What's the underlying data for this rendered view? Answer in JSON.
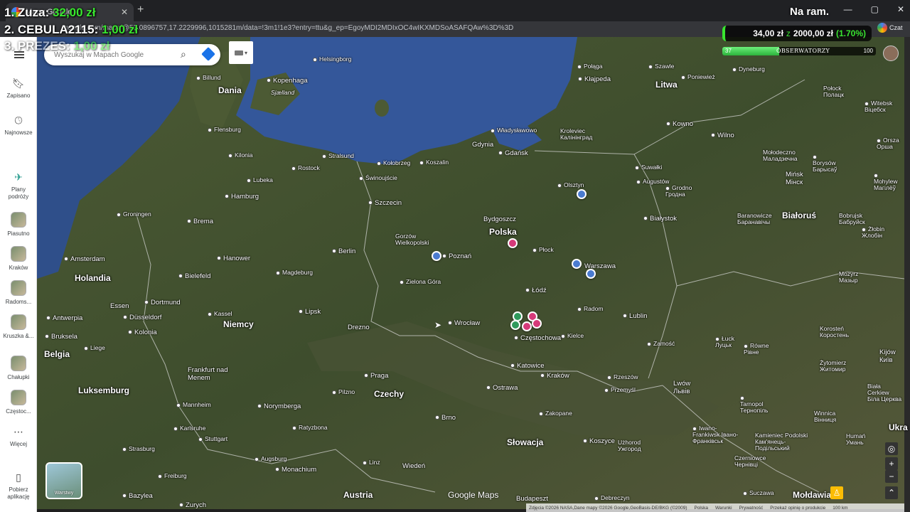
{
  "browser": {
    "tab_title": "Mapy Google",
    "url": "google.com/maps/@52.0896757,17.2229996,1015281m/data=!3m1!1e3?entry=ttu&g_ep=EgoyMDI2MDIxOC4wIKXMDSoASAFQAw%3D%3D",
    "win_min": "—",
    "win_max": "▢",
    "win_close": "✕"
  },
  "stream": {
    "leaders": [
      {
        "name": "1. Zuza:",
        "amount": "32,00 zł"
      },
      {
        "name": "2. CEBULA2115:",
        "amount": "1,00 zł"
      },
      {
        "name": "3. PREZES:",
        "amount": "1,00 zł"
      }
    ],
    "status": "Na ram.",
    "goal": {
      "current": "34,00 zł",
      "of": "z",
      "target": "2000,00 zł",
      "percent": "(1.70%)",
      "fraction": 0.017
    },
    "observers": {
      "count": "37",
      "label": "OBSERWATORZY",
      "max": "100",
      "fraction": 0.37
    },
    "chat_label": "Czat"
  },
  "maps": {
    "search_placeholder": "Wyszukaj w Mapach Google",
    "rail": [
      {
        "label": "Zapisano",
        "icon": "bookmark-icon"
      },
      {
        "label": "Najnowsze",
        "icon": "history-icon"
      },
      {
        "label": "Plany podróży",
        "icon": "trip-icon"
      },
      {
        "label": "Piasutno",
        "icon": "place-thumb"
      },
      {
        "label": "Kraków",
        "icon": "place-thumb"
      },
      {
        "label": "Radoms...",
        "icon": "place-thumb"
      },
      {
        "label": "Kruszka &...",
        "icon": "place-thumb"
      },
      {
        "label": "Chałupki",
        "icon": "place-thumb"
      },
      {
        "label": "Częstoc...",
        "icon": "place-thumb"
      },
      {
        "label": "Więcej",
        "icon": "more-icon"
      },
      {
        "label": "Pobierz aplikację",
        "icon": "phone-icon"
      }
    ],
    "layers_label": "Warstwy",
    "brand": "Google Maps",
    "footer": {
      "credits": "Zdjęcia ©2026 NASA,Dane mapy ©2026 Google,GeoBasis-DE/BKG (©2009)",
      "links": [
        "Polska",
        "Warunki",
        "Prywatność",
        "Przekaż opinię o produkcie"
      ],
      "scale": "100 km"
    },
    "countries": [
      {
        "name": "Dania"
      },
      {
        "name": "Litwa"
      },
      {
        "name": "Polska"
      },
      {
        "name": "Holandia"
      },
      {
        "name": "Niemcy"
      },
      {
        "name": "Belgia"
      },
      {
        "name": "Luksemburg"
      },
      {
        "name": "Czechy"
      },
      {
        "name": "Słowacja"
      },
      {
        "name": "Austria"
      },
      {
        "name": "Białoruś"
      },
      {
        "name": "Mołdawia"
      },
      {
        "name": "Ukra"
      }
    ],
    "cities": [
      {
        "name": "Helsingborg"
      },
      {
        "name": "Kopenhaga"
      },
      {
        "name": "Sjælland"
      },
      {
        "name": "Billund"
      },
      {
        "name": "Flensburg"
      },
      {
        "name": "Kilonia"
      },
      {
        "name": "Lubeka"
      },
      {
        "name": "Rostock"
      },
      {
        "name": "Stralsund"
      },
      {
        "name": "Hamburg"
      },
      {
        "name": "Groningen"
      },
      {
        "name": "Brema"
      },
      {
        "name": "Amsterdam"
      },
      {
        "name": "Hanower"
      },
      {
        "name": "Berlin"
      },
      {
        "name": "Bielefeld"
      },
      {
        "name": "Magdeburg"
      },
      {
        "name": "Dortmund"
      },
      {
        "name": "Essen"
      },
      {
        "name": "Düsseldorf"
      },
      {
        "name": "Antwerpia"
      },
      {
        "name": "Kolonia"
      },
      {
        "name": "Kassel"
      },
      {
        "name": "Lipsk"
      },
      {
        "name": "Bruksela"
      },
      {
        "name": "Liege"
      },
      {
        "name": "Drezno"
      },
      {
        "name": "Frankfurt nad Menem"
      },
      {
        "name": "Mannheim"
      },
      {
        "name": "Norymberga"
      },
      {
        "name": "Karlsruhe"
      },
      {
        "name": "Stuttgart"
      },
      {
        "name": "Strasburg"
      },
      {
        "name": "Freiburg"
      },
      {
        "name": "Augsburg"
      },
      {
        "name": "Monachium"
      },
      {
        "name": "Bazylea"
      },
      {
        "name": "Zurych"
      },
      {
        "name": "Ratyzbona"
      },
      {
        "name": "Pilzno"
      },
      {
        "name": "Praga"
      },
      {
        "name": "Linz"
      },
      {
        "name": "Wiedeń"
      },
      {
        "name": "Brno"
      },
      {
        "name": "Ostrawa"
      },
      {
        "name": "Budapeszt"
      },
      {
        "name": "Świnoujście"
      },
      {
        "name": "Kołobrzeg"
      },
      {
        "name": "Koszalin"
      },
      {
        "name": "Szczecin"
      },
      {
        "name": "Gorzów Wielkopolski"
      },
      {
        "name": "Zielona Góra"
      },
      {
        "name": "Poznań"
      },
      {
        "name": "Wrocław"
      },
      {
        "name": "Władysławowo"
      },
      {
        "name": "Gdynia"
      },
      {
        "name": "Gdańsk"
      },
      {
        "name": "Bydgoszcz"
      },
      {
        "name": "Płock"
      },
      {
        "name": "Warszawa"
      },
      {
        "name": "Łódź"
      },
      {
        "name": "Radom"
      },
      {
        "name": "Kielce"
      },
      {
        "name": "Częstochowa"
      },
      {
        "name": "Katowice"
      },
      {
        "name": "Kraków"
      },
      {
        "name": "Rzeszów"
      },
      {
        "name": "Przemyśl"
      },
      {
        "name": "Lublin"
      },
      {
        "name": "Zamość"
      },
      {
        "name": "Olsztyn"
      },
      {
        "name": "Augustów"
      },
      {
        "name": "Białystok"
      },
      {
        "name": "Suwałki"
      },
      {
        "name": "Połąga"
      },
      {
        "name": "Kłajpeda"
      },
      {
        "name": "Szawle"
      },
      {
        "name": "Poniewież"
      },
      {
        "name": "Kowno"
      },
      {
        "name": "Wilno"
      },
      {
        "name": "Dyneburg"
      },
      {
        "name": "Połock Полацк"
      },
      {
        "name": "Witebsk Віцебск"
      },
      {
        "name": "Orsza Орша"
      },
      {
        "name": "Kroleviec Калінінград"
      },
      {
        "name": "Grodno Гродна"
      },
      {
        "name": "Mołodeczno Маладзечна"
      },
      {
        "name": "Borysów Барысаў"
      },
      {
        "name": "Mińsk Мінск"
      },
      {
        "name": "Mohylew Магілёў"
      },
      {
        "name": "Baranowicze Баранавічы"
      },
      {
        "name": "Bobrujsk Бабруйск"
      },
      {
        "name": "Żłobin Жлобін"
      },
      {
        "name": "Mozyrz Мазыр"
      },
      {
        "name": "Łuck Луцьк"
      },
      {
        "name": "Równe Рівне"
      },
      {
        "name": "Korosteń Коростень"
      },
      {
        "name": "Kijów Київ"
      },
      {
        "name": "Żytomierz Житомир"
      },
      {
        "name": "Biała Cerkiew Біла Церква"
      },
      {
        "name": "Lwów Львів"
      },
      {
        "name": "Tarnopol Тернопіль"
      },
      {
        "name": "Winnica Вінниця"
      },
      {
        "name": "Iwano-Frankiwsk Івано-Франківськ"
      },
      {
        "name": "Kamieniec Podolski Кам'янець-Подільський"
      },
      {
        "name": "Humań Умань"
      },
      {
        "name": "Czerniowce Чернівці"
      },
      {
        "name": "Użhorod Ужгород"
      },
      {
        "name": "Koszyce"
      },
      {
        "name": "Zakopane"
      },
      {
        "name": "Debreczyn"
      },
      {
        "name": "Suczawa"
      }
    ]
  }
}
